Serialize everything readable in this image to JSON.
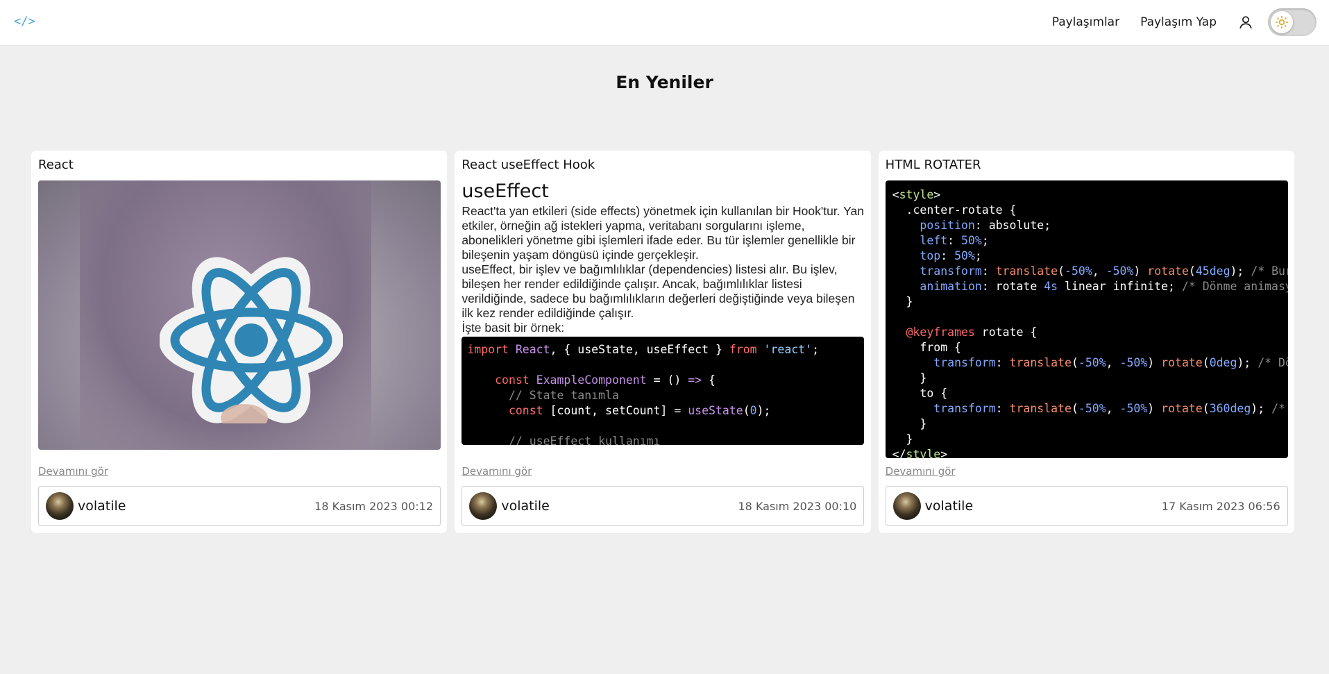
{
  "header": {
    "logo_glyph": "</>",
    "nav": [
      "Paylaşımlar",
      "Paylaşım Yap"
    ],
    "user_icon": "user-icon",
    "theme_icon": "sun-icon"
  },
  "page_title": "En Yeniler",
  "cards": [
    {
      "title": "React",
      "image_alt": "React logo sticker",
      "more": "Devamını gör",
      "author": "volatile",
      "date": "18 Kasım 2023 00:12"
    },
    {
      "title": "React useEffect Hook",
      "heading": "useEffect",
      "paragraphs": [
        "React'ta yan etkileri (side effects) yönetmek için kullanılan bir Hook'tur. Yan etkiler, örneğin ağ istekleri yapma, veritabanı sorgularını işleme, abonelikleri yönetme gibi işlemleri ifade eder. Bu tür işlemler genellikle bir bileşenin yaşam döngüsü içinde gerçekleşir.",
        "useEffect, bir işlev ve bağımlılıklar (dependencies) listesi alır. Bu işlev, bileşen her render edildiğinde çalışır. Ancak, bağımlılıklar listesi verildiğinde, sadece bu bağımlılıkların değerleri değiştiğinde veya bileşen ilk kez render edildiğinde çalışır.",
        "İşte basit bir örnek:"
      ],
      "code": {
        "line1": [
          "import",
          " React",
          ", { useState, useEffect } ",
          "from",
          " 'react'",
          ";"
        ],
        "line2": [
          "const",
          " ExampleComponent",
          " = () ",
          "=>",
          " {"
        ],
        "line3": "// State tanımla",
        "line4": [
          "const",
          " [count, setCount] = ",
          "useState",
          "(",
          "0",
          ");"
        ],
        "line5": "// useEffect kullanımı"
      },
      "more": "Devamını gör",
      "author": "volatile",
      "date": "18 Kasım 2023 00:10"
    },
    {
      "title": "HTML ROTATER",
      "code_lines": [
        "<style>",
        "  .center-rotate {",
        "    position: absolute;",
        "    left: 50%;",
        "    top: 50%;",
        "    transform: translate(-50%, -50%) rotate(45deg); /* Bur",
        "    animation: rotate 4s linear infinite; /* Dönme animasy",
        "  }",
        "",
        "  @keyframes rotate {",
        "    from {",
        "      transform: translate(-50%, -50%) rotate(0deg); /* Dö",
        "    }",
        "    to {",
        "      transform: translate(-50%, -50%) rotate(360deg); /*",
        "    }",
        "  }",
        "</style>"
      ],
      "more": "Devamını gör",
      "author": "volatile",
      "date": "17 Kasım 2023 06:56"
    }
  ],
  "colors": {
    "background": "#efefef",
    "logo": "#4aa3d8",
    "react_blue": "#2f86b5",
    "code_bg": "#000000"
  }
}
